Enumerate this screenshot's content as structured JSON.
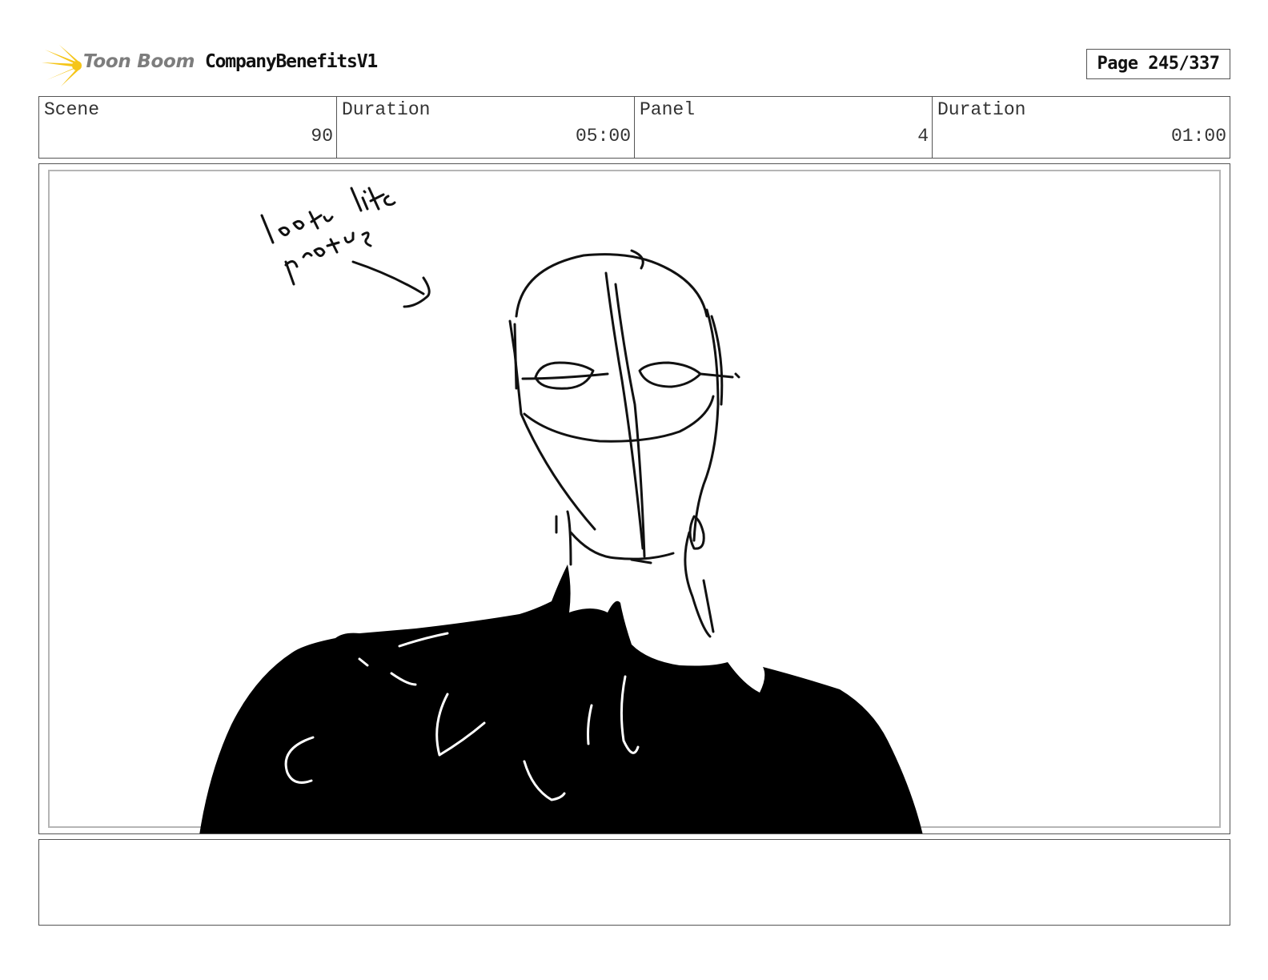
{
  "header": {
    "logo_text": "Toon Boom",
    "project_title": "CompanyBenefitsV1",
    "page_label": "Page 245/337"
  },
  "info": {
    "scene_label": "Scene",
    "scene_value": "90",
    "scene_duration_label": "Duration",
    "scene_duration_value": "05:00",
    "panel_label": "Panel",
    "panel_value": "4",
    "panel_duration_label": "Duration",
    "panel_duration_value": "01:00"
  },
  "panel": {
    "handwritten_note": "looks like protag"
  },
  "icons": {
    "logo": "toon-boom-starburst-icon"
  },
  "colors": {
    "logo_star": "#f5c518",
    "border": "#555555",
    "inner_border": "#b5b5b5"
  }
}
